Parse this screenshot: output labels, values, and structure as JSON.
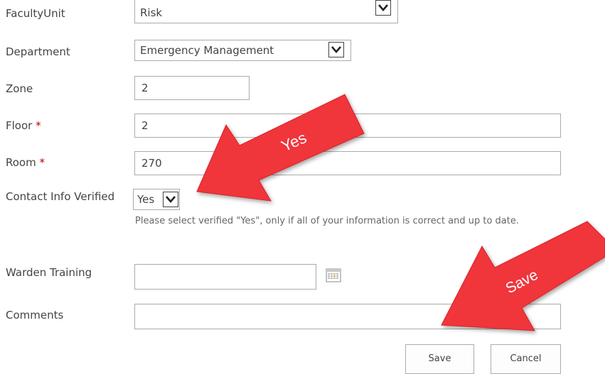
{
  "fields": {
    "faculty_unit": {
      "label": "FacultyUnit",
      "value": "Risk"
    },
    "department": {
      "label": "Department",
      "value": "Emergency Management"
    },
    "zone": {
      "label": "Zone",
      "value": "2"
    },
    "floor": {
      "label": "Floor",
      "required_mark": "*",
      "value": "2"
    },
    "room": {
      "label": "Room",
      "required_mark": "*",
      "value": "270"
    },
    "contact_verified": {
      "label": "Contact Info Verified",
      "value": "Yes",
      "hint": "Please select verified \"Yes\", only if all of your information is correct and up to date."
    },
    "warden_training": {
      "label": "Warden Training",
      "value": ""
    },
    "comments": {
      "label": "Comments",
      "value": ""
    }
  },
  "buttons": {
    "save": "Save",
    "cancel": "Cancel"
  },
  "annotations": {
    "yes_arrow_text": "Yes",
    "save_arrow_text": "Save",
    "arrow_color": "#f0363b"
  },
  "icons": {
    "calendar": "calendar-icon",
    "dropdown": "chevron-down-icon"
  }
}
